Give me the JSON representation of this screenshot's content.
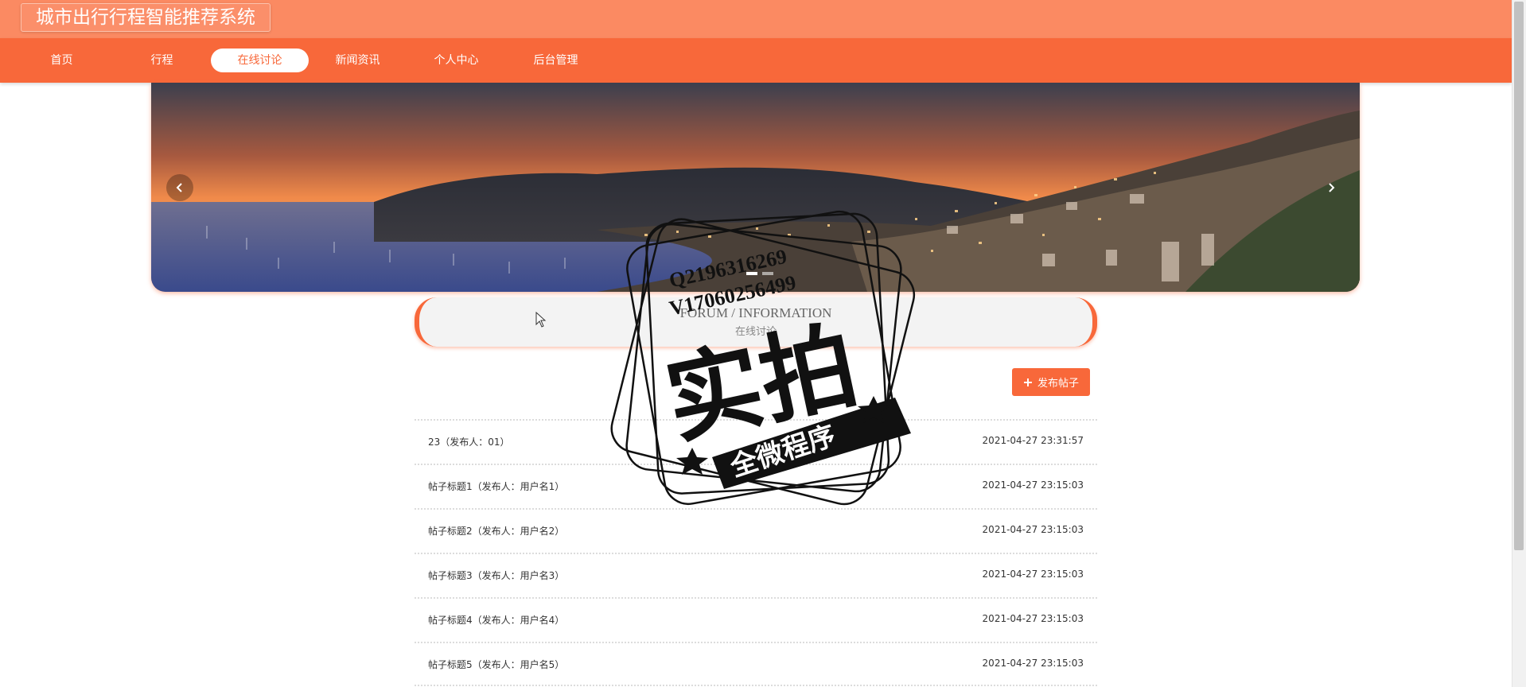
{
  "app": {
    "title": "城市出行行程智能推荐系统"
  },
  "nav": {
    "items": [
      {
        "label": "首页"
      },
      {
        "label": "行程"
      },
      {
        "label": "在线讨论"
      },
      {
        "label": "新闻资讯"
      },
      {
        "label": "个人中心"
      },
      {
        "label": "后台管理"
      }
    ],
    "active_index": 2
  },
  "banner": {
    "prev_icon": "chevron-left-icon",
    "next_icon": "chevron-right-icon",
    "dots": 2,
    "active_dot": 0
  },
  "section": {
    "title_en": "FORUM / INFORMATION",
    "title_cn": "在线讨论"
  },
  "actions": {
    "publish_label": "发布帖子",
    "publish_icon": "plus-icon"
  },
  "posts": [
    {
      "title": "23（发布人：01）",
      "time": "2021-04-27 23:31:57"
    },
    {
      "title": "帖子标题1（发布人：用户名1）",
      "time": "2021-04-27 23:15:03"
    },
    {
      "title": "帖子标题2（发布人：用户名2）",
      "time": "2021-04-27 23:15:03"
    },
    {
      "title": "帖子标题3（发布人：用户名3）",
      "time": "2021-04-27 23:15:03"
    },
    {
      "title": "帖子标题4（发布人：用户名4）",
      "time": "2021-04-27 23:15:03"
    },
    {
      "title": "帖子标题5（发布人：用户名5）",
      "time": "2021-04-27 23:15:03"
    }
  ],
  "watermark": {
    "line1": "Q2196316269",
    "line2": "V17060256499",
    "main": "实拍",
    "ribbon": "全微程序"
  },
  "colors": {
    "accent": "#f8683a",
    "topbar": "#fb8a62"
  }
}
